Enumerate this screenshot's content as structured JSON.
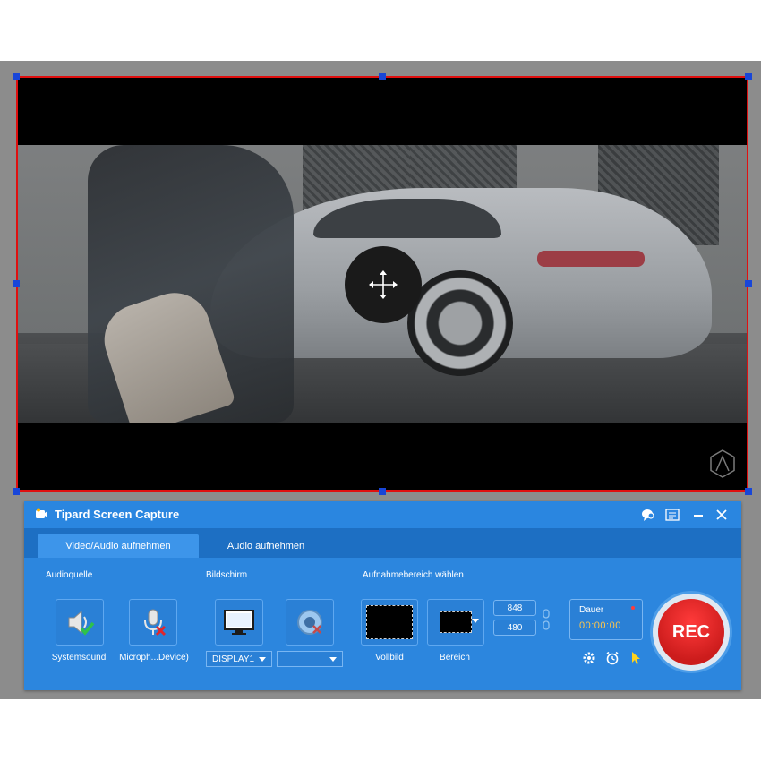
{
  "window": {
    "title": "Tipard Screen Capture",
    "controls": [
      "feedback-icon",
      "menu-icon",
      "minimize-icon",
      "close-icon"
    ]
  },
  "tabs": [
    {
      "label": "Video/Audio aufnehmen",
      "active": true
    },
    {
      "label": "Audio aufnehmen",
      "active": false
    }
  ],
  "audio": {
    "section_label": "Audioquelle",
    "system_sound_label": "Systemsound",
    "system_sound_enabled": true,
    "microphone_label": "Microph...Device)",
    "microphone_enabled": false
  },
  "screen": {
    "section_label": "Bildschirm",
    "display_value": "DISPLAY1",
    "webcam_value": ""
  },
  "area": {
    "section_label": "Aufnahmebereich wählen",
    "fullscreen_label": "Vollbild",
    "region_label": "Bereich",
    "width": "848",
    "height": "480"
  },
  "timer": {
    "label": "Dauer",
    "value": "00:00:00"
  },
  "rec_label": "REC",
  "tools": [
    "settings-icon",
    "alarm-icon",
    "cursor-icon"
  ],
  "colors": {
    "accent": "#2c86de",
    "capture_border": "#e01010",
    "rec_button": "#d81f1f",
    "timer_text": "#ffc64a"
  }
}
